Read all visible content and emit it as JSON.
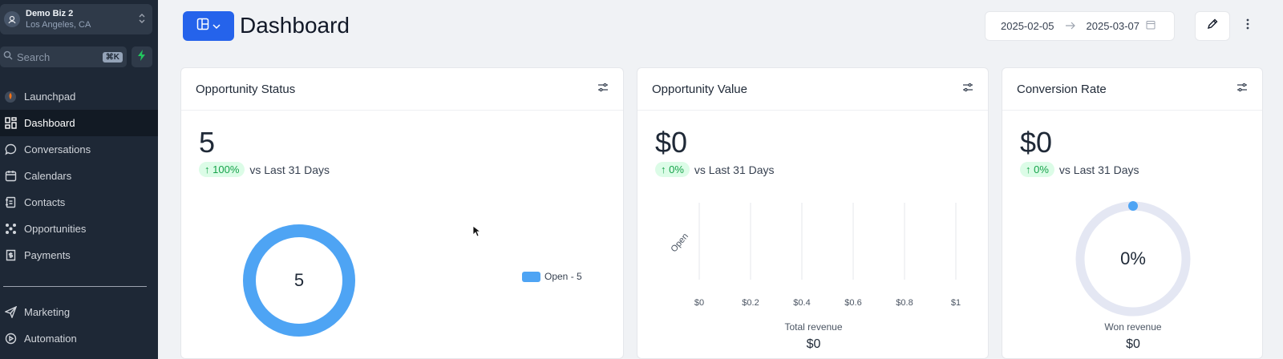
{
  "sidebar": {
    "business": {
      "name": "Demo Biz 2",
      "location": "Los Angeles, CA"
    },
    "search": {
      "placeholder": "Search",
      "shortcut": "⌘K"
    },
    "items": [
      {
        "label": "Launchpad",
        "icon": "launchpad-icon",
        "active": false
      },
      {
        "label": "Dashboard",
        "icon": "dashboard-icon",
        "active": true
      },
      {
        "label": "Conversations",
        "icon": "chat-icon",
        "active": false
      },
      {
        "label": "Calendars",
        "icon": "calendar-icon",
        "active": false
      },
      {
        "label": "Contacts",
        "icon": "contacts-icon",
        "active": false
      },
      {
        "label": "Opportunities",
        "icon": "opportunities-icon",
        "active": false
      },
      {
        "label": "Payments",
        "icon": "payments-icon",
        "active": false
      },
      {
        "label": "Marketing",
        "icon": "send-icon",
        "active": false
      },
      {
        "label": "Automation",
        "icon": "automation-icon",
        "active": false
      }
    ]
  },
  "header": {
    "title": "Dashboard",
    "date_start": "2025-02-05",
    "date_end": "2025-03-07"
  },
  "cards": {
    "opportunity_status": {
      "title": "Opportunity Status",
      "value": "5",
      "change": "100%",
      "comparison": "vs Last 31 Days",
      "donut_center": "5",
      "legend": "Open - 5"
    },
    "opportunity_value": {
      "title": "Opportunity Value",
      "value": "$0",
      "change": "0%",
      "comparison": "vs Last 31 Days",
      "footer_label": "Total revenue",
      "footer_value": "$0"
    },
    "conversion_rate": {
      "title": "Conversion Rate",
      "value": "$0",
      "change": "0%",
      "comparison": "vs Last 31 Days",
      "gauge_center": "0%",
      "footer_label": "Won revenue",
      "footer_value": "$0"
    }
  },
  "colors": {
    "accent": "#2563eb",
    "donut": "#4ea4f4",
    "positive": "#16a34a",
    "sidebar": "#1e2836"
  },
  "chart_data": [
    {
      "type": "pie",
      "categories": [
        "Open"
      ],
      "values": [
        5
      ],
      "legend": "right"
    },
    {
      "type": "bar",
      "orientation": "horizontal",
      "categories": [
        "Open"
      ],
      "values": [
        0
      ],
      "xlabel": "Total revenue",
      "x_ticks": [
        "$0",
        "$0.2",
        "$0.4",
        "$0.6",
        "$0.8",
        "$1"
      ],
      "xlim": [
        0,
        1
      ],
      "grid": true
    },
    {
      "type": "pie",
      "categories": [
        "Won"
      ],
      "values": [
        0
      ],
      "label": "0%"
    }
  ]
}
